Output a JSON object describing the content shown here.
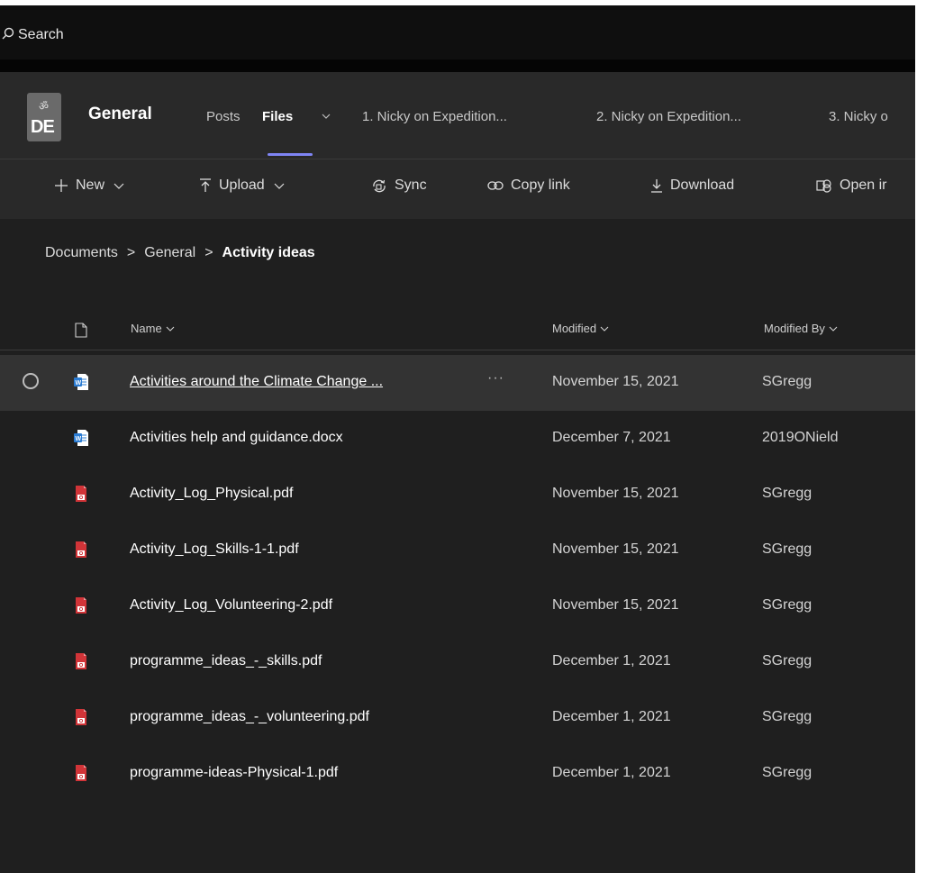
{
  "search": {
    "placeholder": "Search"
  },
  "team": {
    "logo_text": "DE",
    "logo_glyph": "ॐ"
  },
  "header": {
    "channel": "General",
    "tabs": [
      {
        "label": "Posts"
      },
      {
        "label": "Files",
        "active": true
      },
      {
        "label": "1. Nicky on Expedition..."
      },
      {
        "label": "2. Nicky on Expedition..."
      },
      {
        "label": "3. Nicky o"
      }
    ]
  },
  "toolbar": {
    "new_label": "New",
    "upload_label": "Upload",
    "sync_label": "Sync",
    "copy_link_label": "Copy link",
    "download_label": "Download",
    "open_in_label": "Open ir"
  },
  "breadcrumb": {
    "items": [
      "Documents",
      "General",
      "Activity ideas"
    ],
    "separator": ">"
  },
  "columns": {
    "name": "Name",
    "modified": "Modified",
    "modified_by": "Modified By"
  },
  "files": [
    {
      "name": "Activities around the Climate Change ...",
      "modified": "November 15, 2021",
      "modified_by": "SGregg",
      "type": "word"
    },
    {
      "name": "Activities help and guidance.docx",
      "modified": "December 7, 2021",
      "modified_by": "2019ONield",
      "type": "word"
    },
    {
      "name": "Activity_Log_Physical.pdf",
      "modified": "November 15, 2021",
      "modified_by": "SGregg",
      "type": "pdf"
    },
    {
      "name": "Activity_Log_Skills-1-1.pdf",
      "modified": "November 15, 2021",
      "modified_by": "SGregg",
      "type": "pdf"
    },
    {
      "name": "Activity_Log_Volunteering-2.pdf",
      "modified": "November 15, 2021",
      "modified_by": "SGregg",
      "type": "pdf"
    },
    {
      "name": "programme_ideas_-_skills.pdf",
      "modified": "December 1, 2021",
      "modified_by": "SGregg",
      "type": "pdf"
    },
    {
      "name": "programme_ideas_-_volunteering.pdf",
      "modified": "December 1, 2021",
      "modified_by": "SGregg",
      "type": "pdf"
    },
    {
      "name": "programme-ideas-Physical-1.pdf",
      "modified": "December 1, 2021",
      "modified_by": "SGregg",
      "type": "pdf"
    }
  ],
  "row_more_label": "···",
  "colors": {
    "accent": "#7f85f5",
    "word": "#2b7cd3",
    "pdf": "#d13438",
    "background": "#1f1f1f",
    "header": "#292929"
  },
  "icons": {
    "search": "search-icon",
    "new": "plus-icon",
    "upload": "upload-icon",
    "sync": "sync-icon",
    "copy_link": "link-icon",
    "download": "download-icon",
    "open_in": "open-in-app-icon",
    "file_type": "document-icon",
    "word": "word-file-icon",
    "pdf": "pdf-file-icon",
    "sort": "chevron-down-icon"
  }
}
